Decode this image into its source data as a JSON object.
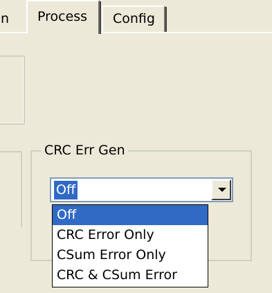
{
  "tabs": [
    {
      "label": "n"
    },
    {
      "label": "Process"
    },
    {
      "label": "Config"
    }
  ],
  "crc_group": {
    "caption": "CRC Err Gen",
    "combo_value": "Off",
    "options": [
      "Off",
      "CRC Error Only",
      "CSum Error Only",
      "CRC & CSum Error"
    ]
  },
  "colors": {
    "background": "#ece9d8",
    "selection": "#316ac5"
  },
  "icons": {
    "dropdown_arrow": "chevron-down-icon"
  }
}
